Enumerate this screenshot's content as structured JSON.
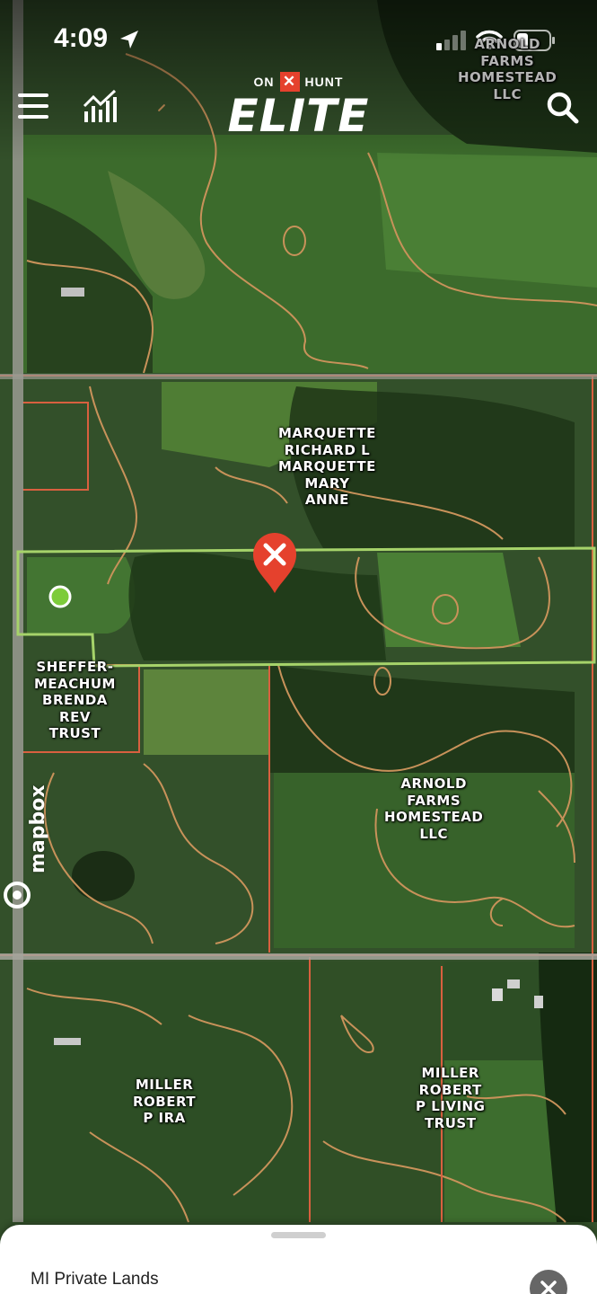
{
  "status_bar": {
    "time": "4:09"
  },
  "brand": {
    "top_left": "ON",
    "top_mark": "✕",
    "top_right": "HUNT",
    "main": "ELITE"
  },
  "parcel_labels": {
    "arnold_top": [
      "ARNOLD",
      "FARMS",
      "HOMESTEAD",
      "LLC"
    ],
    "marquette": [
      "MARQUETTE",
      "RICHARD L",
      "MARQUETTE",
      "MARY",
      "ANNE"
    ],
    "sheffer": [
      "SHEFFER-",
      "MEACHUM",
      "BRENDA",
      "REV",
      "TRUST"
    ],
    "arnold_mid": [
      "ARNOLD",
      "FARMS",
      "HOMESTEAD",
      "LLC"
    ],
    "miller_ira": [
      "MILLER",
      "ROBERT",
      "P IRA"
    ],
    "miller_trust": [
      "MILLER",
      "ROBERT",
      "P LIVING",
      "TRUST"
    ]
  },
  "attribution": "mapbox",
  "sheet": {
    "title": "MI Private Lands"
  },
  "colors": {
    "selection": "#a6d36a",
    "boundary": "#d9603f",
    "contour": "#c8925a",
    "pin": "#e5412d",
    "marker": "#7dcb3a"
  },
  "icons": {
    "menu": "hamburger-icon",
    "stats": "chart-icon",
    "search": "search-icon",
    "pin": "map-pin-icon",
    "close": "close-icon"
  }
}
